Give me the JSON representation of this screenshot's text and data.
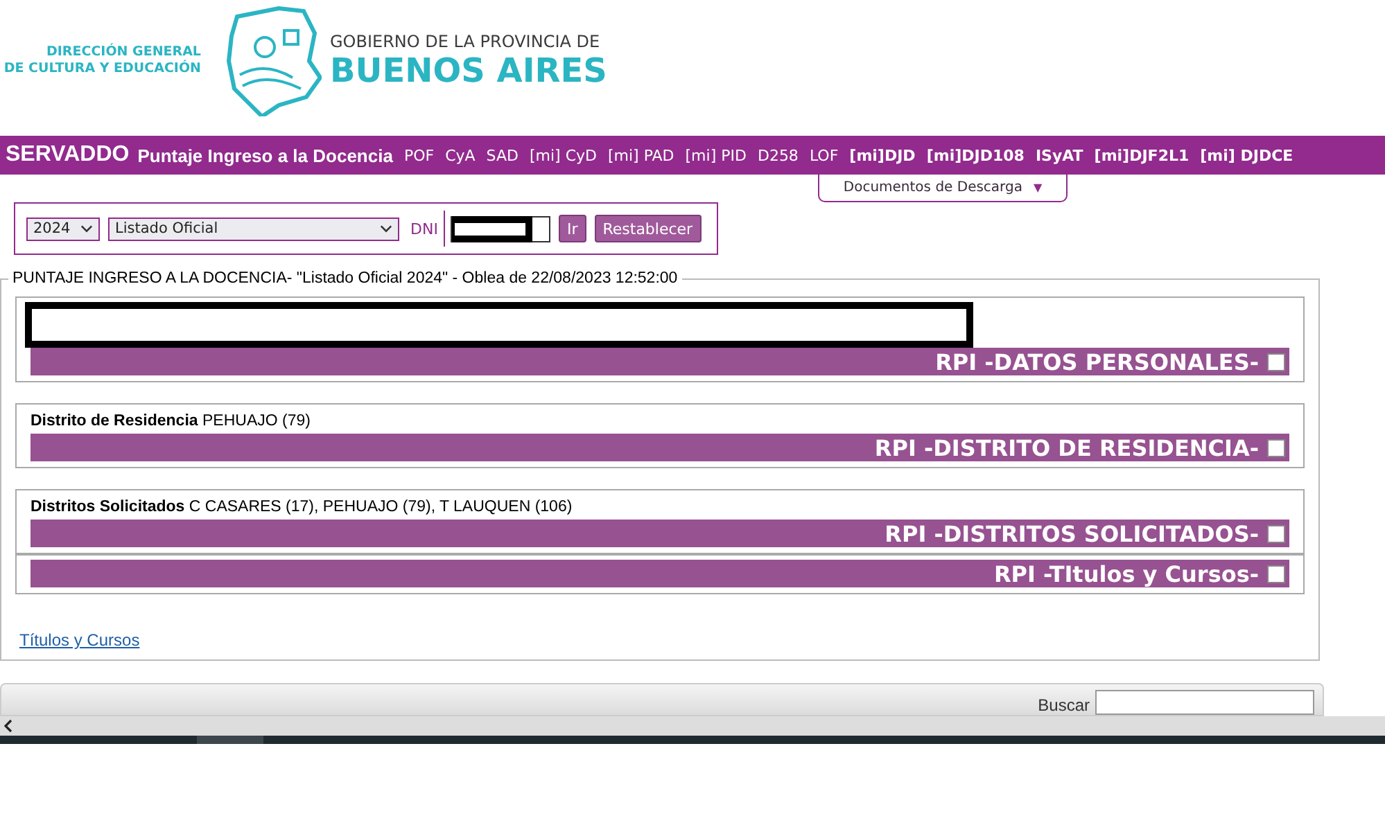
{
  "header": {
    "left_logo": [
      "DIRECCIÓN GENERAL",
      "DE CULTURA Y EDUCACIÓN"
    ],
    "right_logo_top": "GOBIERNO DE LA PROVINCIA DE",
    "right_logo_bottom": "BUENOS AIRES"
  },
  "nav": {
    "brand": "SERVADDO",
    "title": "Puntaje Ingreso a la Docencia",
    "links": [
      {
        "label": "POF",
        "bold": false
      },
      {
        "label": "CyA",
        "bold": false
      },
      {
        "label": "SAD",
        "bold": false
      },
      {
        "label": "[mi] CyD",
        "bold": false
      },
      {
        "label": "[mi] PAD",
        "bold": false
      },
      {
        "label": "[mi] PID",
        "bold": false
      },
      {
        "label": "D258",
        "bold": false
      },
      {
        "label": "LOF",
        "bold": false
      },
      {
        "label": "[mi]DJD",
        "bold": true
      },
      {
        "label": "[mi]DJD108",
        "bold": true
      },
      {
        "label": "ISyAT",
        "bold": true
      },
      {
        "label": "[mi]DJF2L1",
        "bold": true
      },
      {
        "label": "[mi] DJDCE",
        "bold": true
      }
    ],
    "dropdown": {
      "label": "Documentos de Descarga",
      "caret": "▼"
    }
  },
  "filter": {
    "year": "2024",
    "list": "Listado Oficial",
    "dni_label": "DNI",
    "buttons": [
      "Ir",
      "Restablecer"
    ]
  },
  "fieldset": {
    "legend": "PUNTAJE INGRESO A LA DOCENCIA- \"Listado Oficial 2024\" - Oblea de 22/08/2023 12:52:00",
    "sections": [
      {
        "kind": "redacted",
        "bar": "RPI -DATOS PERSONALES-",
        "checked": false
      },
      {
        "kind": "info",
        "label": "Distrito de Residencia",
        "value": "PEHUAJO (79)",
        "bar": "RPI -DISTRITO DE RESIDENCIA-",
        "checked": false
      },
      {
        "kind": "info",
        "label": "Distritos Solicitados",
        "value": "C CASARES (17), PEHUAJO (79), T LAUQUEN (106)",
        "bar": "RPI -DISTRITOS SOLICITADOS-",
        "checked": false
      },
      {
        "kind": "bar",
        "bar": "RPI -TItulos y Cursos-",
        "checked": false
      }
    ],
    "link": "Títulos y Cursos"
  },
  "bottom": {
    "search_label": "Buscar"
  }
}
